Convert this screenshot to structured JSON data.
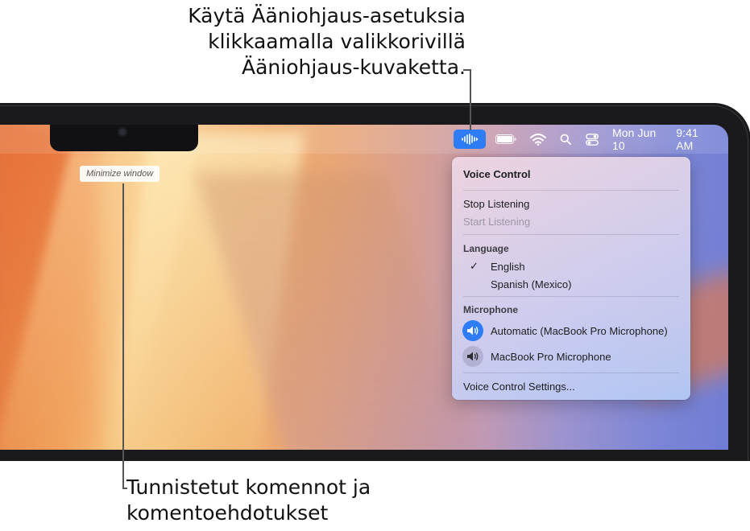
{
  "callouts": {
    "top_lines": [
      "Käytä Ääniohjaus-asetuksia",
      "klikkaamalla valikkorivillä",
      "Ääniohjaus-kuvaketta."
    ],
    "bottom_lines": [
      "Tunnistetut komennot ja",
      "komentoehdotukset"
    ]
  },
  "menubar": {
    "date": "Mon Jun 10",
    "time": "9:41 AM",
    "icons": [
      "voice-control-icon",
      "battery-icon",
      "wifi-icon",
      "spotlight-icon",
      "control-center-icon"
    ]
  },
  "hint": {
    "text": "Minimize window"
  },
  "menu": {
    "title": "Voice Control",
    "stop_listening": "Stop Listening",
    "start_listening": "Start Listening",
    "language_header": "Language",
    "languages": [
      {
        "label": "English",
        "checked": true
      },
      {
        "label": "Spanish (Mexico)",
        "checked": false
      }
    ],
    "microphone_header": "Microphone",
    "microphones": [
      {
        "label": "Automatic (MacBook Pro Microphone)",
        "selected": true,
        "icon": "speaker-icon"
      },
      {
        "label": "MacBook Pro Microphone",
        "selected": false,
        "icon": "speaker-icon"
      }
    ],
    "settings": "Voice Control Settings..."
  },
  "colors": {
    "accent": "#2f7df6",
    "bezel": "#1a1a1c"
  }
}
